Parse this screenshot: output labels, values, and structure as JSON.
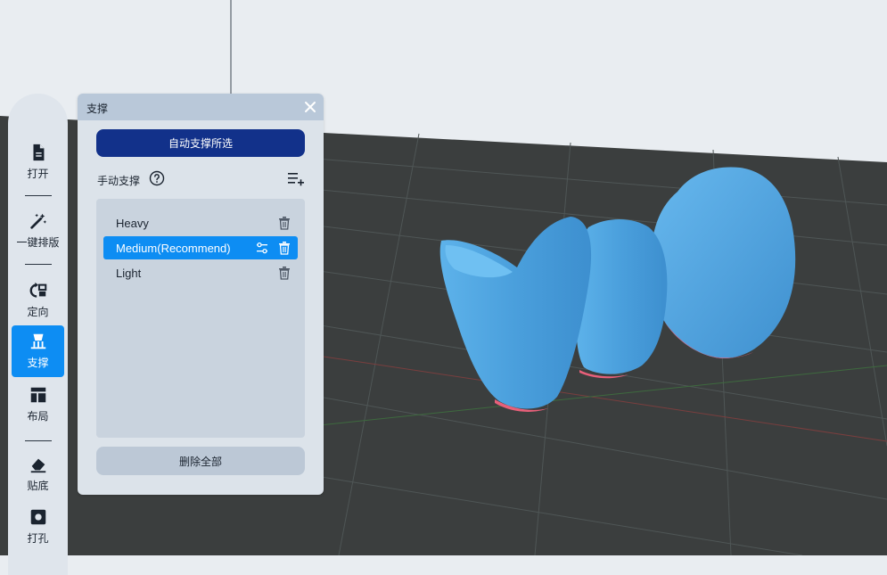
{
  "toolbar": {
    "items": [
      {
        "label": "打开",
        "icon": "file-icon"
      },
      {
        "label": "一键排版",
        "icon": "magic-wand-icon"
      },
      {
        "label": "定向",
        "icon": "orient-icon"
      },
      {
        "label": "支撑",
        "icon": "support-icon"
      },
      {
        "label": "布局",
        "icon": "layout-icon"
      },
      {
        "label": "贴底",
        "icon": "eraser-icon"
      },
      {
        "label": "打孔",
        "icon": "hole-icon"
      }
    ],
    "active": "支撑"
  },
  "panel": {
    "title": "支撑",
    "auto_button": "自动支撑所选",
    "manual_label": "手动支撑",
    "presets": [
      {
        "name": "Heavy",
        "selected": false
      },
      {
        "name": "Medium(Recommend)",
        "selected": true
      },
      {
        "name": "Light",
        "selected": false
      }
    ],
    "delete_all": "删除全部"
  },
  "colors": {
    "accent": "#0d8df3",
    "primary_button": "#12318a",
    "model": "#4da3df",
    "support_contact": "#e8607a",
    "floor": "#3b3e3e",
    "background": "#e9edf1"
  }
}
